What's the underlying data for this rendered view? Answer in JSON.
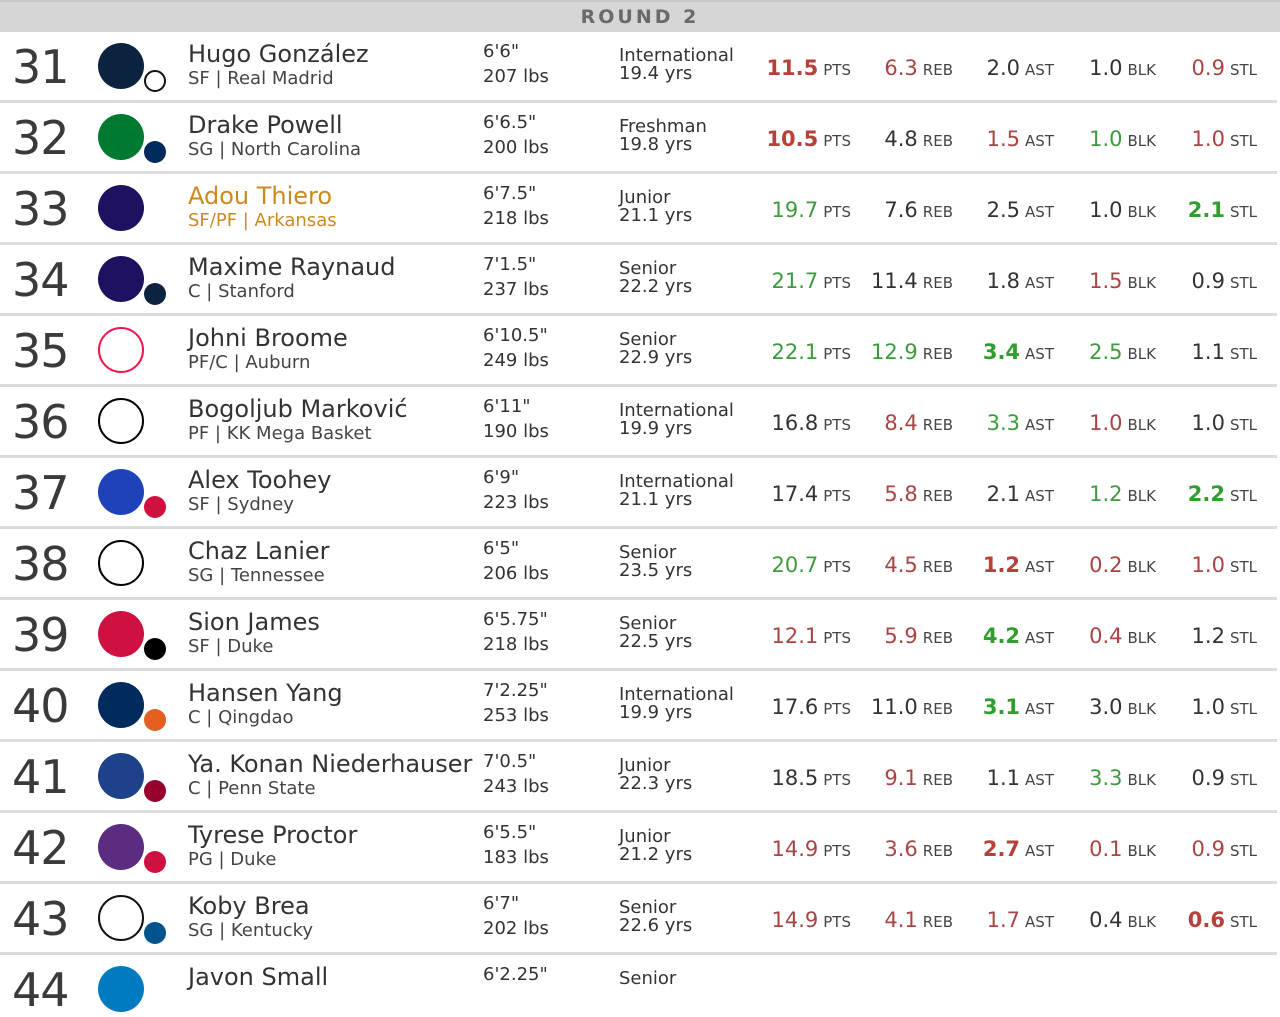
{
  "header": {
    "round_label": "ROUND 2"
  },
  "colors": {
    "neutral": "#333333",
    "red": "#a94442",
    "red_strong": "#b8403a",
    "green": "#3e9a3e",
    "green_strong": "#2f9e2f",
    "highlight": "#cc8a1e"
  },
  "units": {
    "pts": "PTS",
    "reb": "REB",
    "ast": "AST",
    "blk": "BLK",
    "stl": "STL"
  },
  "rows": [
    {
      "pick": "31",
      "name": "Hugo González",
      "sub": "SF | Real Madrid",
      "height": "6'6\"",
      "weight": "207 lbs",
      "class": "International",
      "age": "19.4 yrs",
      "team_logo": "timberwolves-logo",
      "trade_logo": "jazz-logo",
      "pts": "11.5",
      "reb": "6.3",
      "ast": "2.0",
      "blk": "1.0",
      "stl": "0.9",
      "pts_c": "r2",
      "reb_c": "r1",
      "ast_c": "n",
      "blk_c": "n",
      "stl_c": "r1"
    },
    {
      "pick": "32",
      "name": "Drake Powell",
      "sub": "SG | North Carolina",
      "height": "6'6.5\"",
      "weight": "200 lbs",
      "class": "Freshman",
      "age": "19.8 yrs",
      "team_logo": "celtics-logo",
      "trade_logo": "wizards-logo",
      "pts": "10.5",
      "reb": "4.8",
      "ast": "1.5",
      "blk": "1.0",
      "stl": "1.0",
      "pts_c": "r2",
      "reb_c": "n",
      "ast_c": "r1",
      "blk_c": "g1",
      "stl_c": "r1"
    },
    {
      "pick": "33",
      "name": "Adou Thiero",
      "sub": "SF/PF | Arkansas",
      "height": "6'7.5\"",
      "weight": "218 lbs",
      "class": "Junior",
      "age": "21.1 yrs",
      "team_logo": "hornets-logo",
      "trade_logo": "",
      "pts": "19.7",
      "reb": "7.6",
      "ast": "2.5",
      "blk": "1.0",
      "stl": "2.1",
      "pts_c": "g1",
      "reb_c": "n",
      "ast_c": "n",
      "blk_c": "n",
      "stl_c": "g2",
      "highlight": true
    },
    {
      "pick": "34",
      "name": "Maxime Raynaud",
      "sub": "C | Stanford",
      "height": "7'1.5\"",
      "weight": "237 lbs",
      "class": "Senior",
      "age": "22.2 yrs",
      "team_logo": "hornets-logo",
      "trade_logo": "pelicans-logo",
      "pts": "21.7",
      "reb": "11.4",
      "ast": "1.8",
      "blk": "1.5",
      "stl": "0.9",
      "pts_c": "g1",
      "reb_c": "n",
      "ast_c": "n",
      "blk_c": "r1",
      "stl_c": "n"
    },
    {
      "pick": "35",
      "name": "Johni Broome",
      "sub": "PF/C | Auburn",
      "height": "6'10.5\"",
      "weight": "249 lbs",
      "class": "Senior",
      "age": "22.9 yrs",
      "team_logo": "76ers-logo",
      "trade_logo": "",
      "pts": "22.1",
      "reb": "12.9",
      "ast": "3.4",
      "blk": "2.5",
      "stl": "1.1",
      "pts_c": "g1",
      "reb_c": "g1",
      "ast_c": "g2",
      "blk_c": "g1",
      "stl_c": "n"
    },
    {
      "pick": "36",
      "name": "Bogoljub Marković",
      "sub": "PF | KK Mega Basket",
      "height": "6'11\"",
      "weight": "190 lbs",
      "class": "International",
      "age": "19.9 yrs",
      "team_logo": "nets-logo",
      "trade_logo": "",
      "pts": "16.8",
      "reb": "8.4",
      "ast": "3.3",
      "blk": "1.0",
      "stl": "1.0",
      "pts_c": "n",
      "reb_c": "r1",
      "ast_c": "g1",
      "blk_c": "r1",
      "stl_c": "n"
    },
    {
      "pick": "37",
      "name": "Alex Toohey",
      "sub": "SF | Sydney",
      "height": "6'9\"",
      "weight": "223 lbs",
      "class": "International",
      "age": "21.1 yrs",
      "team_logo": "pistons-logo",
      "trade_logo": "raptors-logo",
      "pts": "17.4",
      "reb": "5.8",
      "ast": "2.1",
      "blk": "1.2",
      "stl": "2.2",
      "pts_c": "n",
      "reb_c": "r1",
      "ast_c": "n",
      "blk_c": "g1",
      "stl_c": "g2"
    },
    {
      "pick": "38",
      "name": "Chaz Lanier",
      "sub": "SG | Tennessee",
      "height": "6'5\"",
      "weight": "206 lbs",
      "class": "Senior",
      "age": "23.5 yrs",
      "team_logo": "spurs-logo",
      "trade_logo": "",
      "pts": "20.7",
      "reb": "4.5",
      "ast": "1.2",
      "blk": "0.2",
      "stl": "1.0",
      "pts_c": "g1",
      "reb_c": "r1",
      "ast_c": "r2",
      "blk_c": "r1",
      "stl_c": "r1"
    },
    {
      "pick": "39",
      "name": "Sion James",
      "sub": "SF | Duke",
      "height": "6'5.75\"",
      "weight": "218 lbs",
      "class": "Senior",
      "age": "22.5 yrs",
      "team_logo": "raptors-logo",
      "trade_logo": "trail-blazers-logo",
      "pts": "12.1",
      "reb": "5.9",
      "ast": "4.2",
      "blk": "0.4",
      "stl": "1.2",
      "pts_c": "r1",
      "reb_c": "r1",
      "ast_c": "g2",
      "blk_c": "r1",
      "stl_c": "n"
    },
    {
      "pick": "40",
      "name": "Hansen Yang",
      "sub": "C | Qingdao",
      "height": "7'2.25\"",
      "weight": "253 lbs",
      "class": "International",
      "age": "19.9 yrs",
      "team_logo": "wizards-logo",
      "trade_logo": "suns-logo",
      "pts": "17.6",
      "reb": "11.0",
      "ast": "3.1",
      "blk": "3.0",
      "stl": "1.0",
      "pts_c": "n",
      "reb_c": "n",
      "ast_c": "g2",
      "blk_c": "n",
      "stl_c": "n"
    },
    {
      "pick": "41",
      "name": "Ya. Konan Niederhauser",
      "sub": "C | Penn State",
      "height": "7'0.5\"",
      "weight": "243 lbs",
      "class": "Junior",
      "age": "22.3 yrs",
      "team_logo": "warriors-logo",
      "trade_logo": "heat-logo",
      "pts": "18.5",
      "reb": "9.1",
      "ast": "1.1",
      "blk": "3.3",
      "stl": "0.9",
      "pts_c": "n",
      "reb_c": "r1",
      "ast_c": "n",
      "blk_c": "g1",
      "stl_c": "n"
    },
    {
      "pick": "42",
      "name": "Tyrese Proctor",
      "sub": "PG | Duke",
      "height": "6'5.5\"",
      "weight": "183 lbs",
      "class": "Junior",
      "age": "21.2 yrs",
      "team_logo": "kings-logo",
      "trade_logo": "bulls-logo",
      "pts": "14.9",
      "reb": "3.6",
      "ast": "2.7",
      "blk": "0.1",
      "stl": "0.9",
      "pts_c": "r1",
      "reb_c": "r1",
      "ast_c": "r2",
      "blk_c": "r1",
      "stl_c": "r1"
    },
    {
      "pick": "43",
      "name": "Koby Brea",
      "sub": "SG | Kentucky",
      "height": "6'7\"",
      "weight": "202 lbs",
      "class": "Senior",
      "age": "22.6 yrs",
      "team_logo": "jazz-logo",
      "trade_logo": "mavericks-logo",
      "pts": "14.9",
      "reb": "4.1",
      "ast": "1.7",
      "blk": "0.4",
      "stl": "0.6",
      "pts_c": "r1",
      "reb_c": "r1",
      "ast_c": "r1",
      "blk_c": "n",
      "stl_c": "r2"
    }
  ],
  "partial_row": {
    "pick": "44",
    "name": "Javon Small",
    "height": "6'2.25\"",
    "class": "Senior",
    "team_logo": "thunder-logo"
  }
}
